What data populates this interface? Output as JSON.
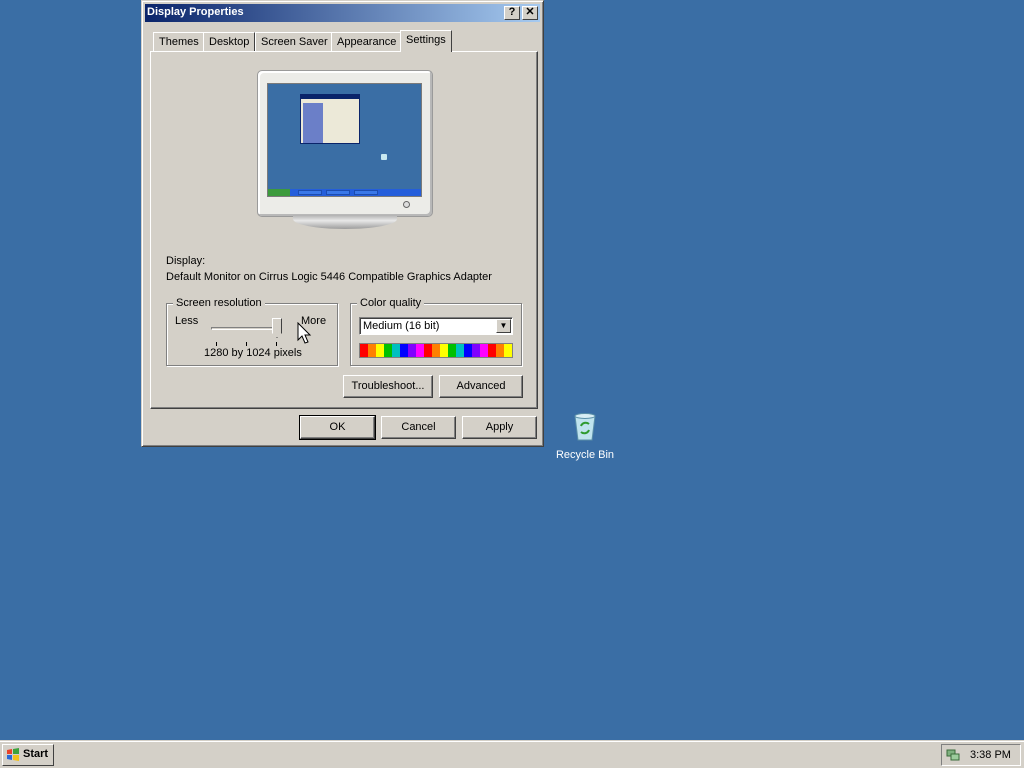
{
  "window": {
    "title": "Display Properties",
    "help_button": "?",
    "close_button": "✕"
  },
  "tabs": [
    {
      "label": "Themes",
      "active": false
    },
    {
      "label": "Desktop",
      "active": false
    },
    {
      "label": "Screen Saver",
      "active": false
    },
    {
      "label": "Appearance",
      "active": false
    },
    {
      "label": "Settings",
      "active": true
    }
  ],
  "display": {
    "label": "Display:",
    "device": "Default Monitor on Cirrus Logic 5446 Compatible Graphics Adapter"
  },
  "resolution": {
    "group_label": "Screen resolution",
    "less_label": "Less",
    "more_label": "More",
    "value": "1280 by 1024 pixels"
  },
  "color_quality": {
    "group_label": "Color quality",
    "selected": "Medium (16 bit)"
  },
  "buttons": {
    "troubleshoot": "Troubleshoot...",
    "advanced": "Advanced",
    "ok": "OK",
    "cancel": "Cancel",
    "apply": "Apply"
  },
  "desktop": {
    "recycle_bin_label": "Recycle Bin"
  },
  "taskbar": {
    "start_label": "Start",
    "clock": "3:38 PM"
  },
  "colors": {
    "desktop_background": "#3a6ea5",
    "titlebar_start": "#0a246a",
    "titlebar_end": "#a6caf0",
    "face": "#d4d0c8"
  }
}
